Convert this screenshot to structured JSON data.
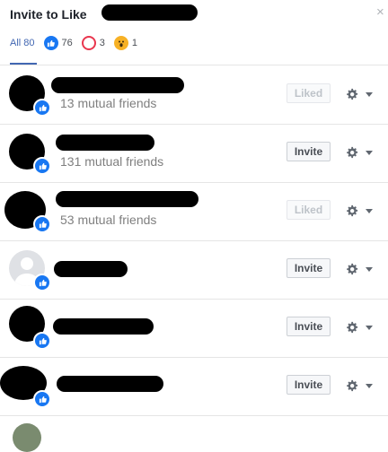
{
  "dialog": {
    "title": "Invite to Like",
    "close_icon": "×"
  },
  "tabs": [
    {
      "label": "All 80",
      "icon": "none"
    },
    {
      "label": "76",
      "icon": "like-reaction-icon"
    },
    {
      "label": "3",
      "icon": "love-reaction-icon"
    },
    {
      "label": "1",
      "icon": "wow-reaction-icon"
    }
  ],
  "people": [
    {
      "mutual": "13 mutual friends",
      "action": "Liked",
      "action_state": "disabled",
      "avatar": "redacted"
    },
    {
      "mutual": "131 mutual friends",
      "action": "Invite",
      "action_state": "enabled",
      "avatar": "redacted"
    },
    {
      "mutual": "53 mutual friends",
      "action": "Liked",
      "action_state": "disabled",
      "avatar": "redacted"
    },
    {
      "mutual": "",
      "action": "Invite",
      "action_state": "enabled",
      "avatar": "default"
    },
    {
      "mutual": "",
      "action": "Invite",
      "action_state": "enabled",
      "avatar": "redacted"
    },
    {
      "mutual": "",
      "action": "Invite",
      "action_state": "enabled",
      "avatar": "redacted"
    }
  ],
  "colors": {
    "accent": "#4267b2",
    "like_blue": "#1877f2",
    "love_red": "#e9364e",
    "wow_yellow": "#f7b125"
  }
}
